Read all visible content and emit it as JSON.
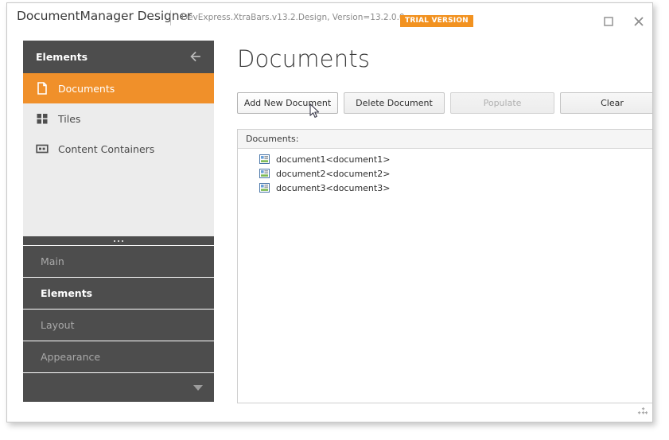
{
  "window": {
    "app_title": "DocumentManager Designer",
    "assembly_info": "DevExpress.XtraBars.v13.2.Design, Version=13.2.0.0",
    "trial_badge": "TRIAL VERSION",
    "maximize_icon": "maximize-icon",
    "close_icon": "close-icon"
  },
  "sidebar": {
    "header_title": "Elements",
    "back_icon": "back-arrow-icon",
    "items": [
      {
        "label": "Documents",
        "icon": "document-icon",
        "active": true
      },
      {
        "label": "Tiles",
        "icon": "tiles-icon",
        "active": false
      },
      {
        "label": "Content Containers",
        "icon": "content-container-icon",
        "active": false
      }
    ],
    "nav": [
      {
        "label": "Main",
        "active": false
      },
      {
        "label": "Elements",
        "active": true
      },
      {
        "label": "Layout",
        "active": false
      },
      {
        "label": "Appearance",
        "active": false
      }
    ],
    "more_icon": "chevron-down-icon"
  },
  "main": {
    "page_title": "Documents",
    "buttons": [
      {
        "label": "Add New Document",
        "state": "hover"
      },
      {
        "label": "Delete Document",
        "state": "normal"
      },
      {
        "label": "Populate",
        "state": "disabled"
      },
      {
        "label": "Clear",
        "state": "normal"
      }
    ],
    "doclist": {
      "header": "Documents:",
      "rows": [
        {
          "label": "document1<document1>",
          "icon": "document-item-icon"
        },
        {
          "label": "document2<document2>",
          "icon": "document-item-icon"
        },
        {
          "label": "document3<document3>",
          "icon": "document-item-icon"
        }
      ]
    },
    "resize_grip_icon": "resize-grip-icon"
  },
  "colors": {
    "accent_orange": "#f0902a",
    "badge_orange": "#f29220",
    "panel_dark": "#4d4d4d",
    "panel_light": "#ececec"
  },
  "cursor": {
    "icon": "mouse-pointer-icon"
  }
}
